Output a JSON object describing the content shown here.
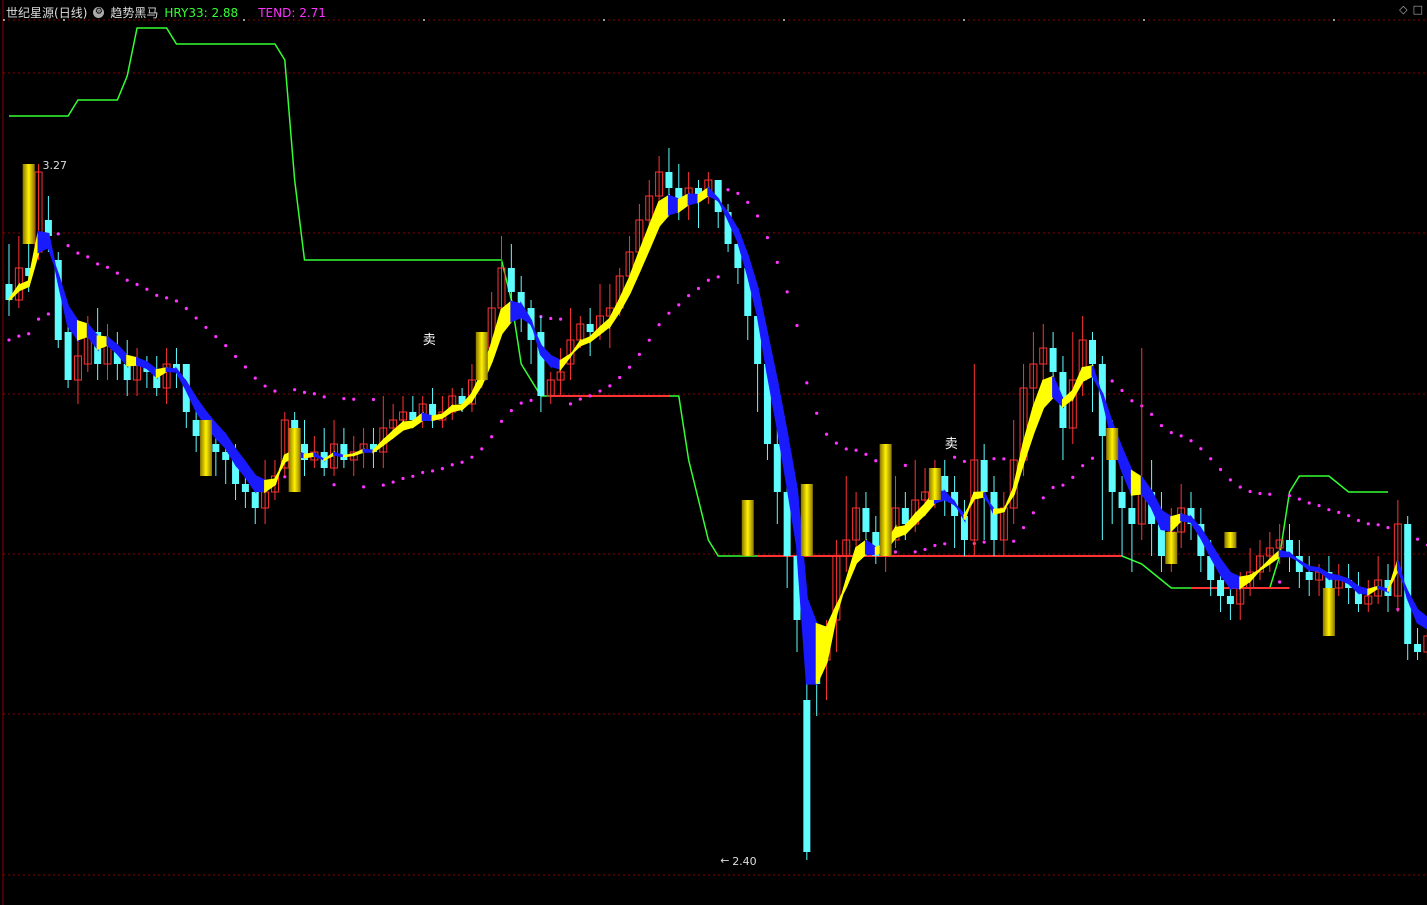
{
  "header": {
    "stock_name": "世纪星源",
    "period": "(日线)",
    "indicator_name": "趋势黑马",
    "hry_label": "HRY33",
    "hry_value": "2.88",
    "tend_label": "TEND",
    "tend_value": "2.71"
  },
  "colors": {
    "background": "#000000",
    "grid": "#8a0000",
    "up": "#ff3333",
    "down": "#5ffcff",
    "hry": "#33ff33",
    "tend": "#ff33ff",
    "ribbon_up": "#ffff00",
    "ribbon_down": "#1a1aff",
    "signal_bar": "#e8c400"
  },
  "chart_data": {
    "type": "candlestick",
    "ylim": [
      2.36,
      3.45
    ],
    "annotations": {
      "high_label": "3.27",
      "low_label": "2.40",
      "sell_marks": [
        "卖",
        "卖"
      ]
    },
    "candles": [
      [
        3.12,
        3.1,
        3.17,
        3.08
      ],
      [
        3.1,
        3.14,
        3.18,
        3.09
      ],
      [
        3.14,
        3.13,
        3.17,
        3.11
      ],
      [
        3.16,
        3.26,
        3.27,
        3.15
      ],
      [
        3.2,
        3.18,
        3.23,
        3.16
      ],
      [
        3.15,
        3.05,
        3.16,
        3.04
      ],
      [
        3.06,
        3.0,
        3.08,
        2.99
      ],
      [
        3.0,
        3.03,
        3.06,
        2.97
      ],
      [
        3.02,
        3.06,
        3.08,
        3.01
      ],
      [
        3.06,
        3.02,
        3.09,
        3.0
      ],
      [
        3.02,
        3.05,
        3.07,
        3.0
      ],
      [
        3.04,
        3.02,
        3.06,
        3.0
      ],
      [
        3.02,
        3.0,
        3.05,
        2.98
      ],
      [
        3.0,
        3.02,
        3.04,
        2.98
      ],
      [
        3.02,
        3.01,
        3.03,
        2.99
      ],
      [
        3.01,
        2.99,
        3.03,
        2.98
      ],
      [
        2.99,
        3.02,
        3.04,
        2.97
      ],
      [
        3.02,
        3.01,
        3.04,
        2.99
      ],
      [
        3.02,
        2.96,
        3.02,
        2.94
      ],
      [
        2.95,
        2.93,
        2.97,
        2.91
      ],
      [
        2.93,
        2.92,
        2.96,
        2.88
      ],
      [
        2.92,
        2.91,
        2.94,
        2.88
      ],
      [
        2.91,
        2.9,
        2.93,
        2.87
      ],
      [
        2.9,
        2.87,
        2.92,
        2.85
      ],
      [
        2.87,
        2.86,
        2.89,
        2.84
      ],
      [
        2.86,
        2.84,
        2.88,
        2.82
      ],
      [
        2.84,
        2.86,
        2.9,
        2.82
      ],
      [
        2.86,
        2.88,
        2.9,
        2.85
      ],
      [
        2.89,
        2.95,
        2.96,
        2.88
      ],
      [
        2.95,
        2.92,
        2.96,
        2.89
      ],
      [
        2.92,
        2.9,
        2.95,
        2.88
      ],
      [
        2.9,
        2.91,
        2.93,
        2.89
      ],
      [
        2.91,
        2.89,
        2.94,
        2.88
      ],
      [
        2.89,
        2.92,
        2.95,
        2.88
      ],
      [
        2.92,
        2.9,
        2.94,
        2.89
      ],
      [
        2.9,
        2.91,
        2.93,
        2.88
      ],
      [
        2.91,
        2.92,
        2.94,
        2.89
      ],
      [
        2.92,
        2.91,
        2.94,
        2.89
      ],
      [
        2.91,
        2.94,
        2.98,
        2.89
      ],
      [
        2.94,
        2.95,
        2.97,
        2.93
      ],
      [
        2.95,
        2.96,
        2.98,
        2.94
      ],
      [
        2.96,
        2.95,
        2.98,
        2.94
      ],
      [
        2.95,
        2.97,
        2.98,
        2.94
      ],
      [
        2.97,
        2.95,
        2.99,
        2.94
      ],
      [
        2.95,
        2.96,
        2.98,
        2.94
      ],
      [
        2.96,
        2.98,
        2.99,
        2.95
      ],
      [
        2.98,
        2.97,
        2.99,
        2.96
      ],
      [
        2.97,
        3.0,
        3.02,
        2.96
      ],
      [
        3.0,
        3.04,
        3.06,
        2.99
      ],
      [
        3.04,
        3.09,
        3.11,
        3.03
      ],
      [
        3.09,
        3.14,
        3.18,
        3.08
      ],
      [
        3.14,
        3.11,
        3.17,
        3.09
      ],
      [
        3.11,
        3.09,
        3.13,
        3.06
      ],
      [
        3.09,
        3.05,
        3.1,
        3.02
      ],
      [
        3.06,
        2.98,
        3.08,
        2.96
      ],
      [
        2.98,
        3.0,
        3.01,
        2.97
      ],
      [
        3.0,
        3.01,
        3.04,
        2.98
      ],
      [
        3.02,
        3.05,
        3.09,
        3.0
      ],
      [
        3.05,
        3.07,
        3.08,
        3.04
      ],
      [
        3.07,
        3.06,
        3.09,
        3.03
      ],
      [
        3.06,
        3.08,
        3.12,
        3.05
      ],
      [
        3.08,
        3.09,
        3.12,
        3.04
      ],
      [
        3.09,
        3.13,
        3.14,
        3.08
      ],
      [
        3.13,
        3.16,
        3.18,
        3.12
      ],
      [
        3.16,
        3.2,
        3.22,
        3.15
      ],
      [
        3.2,
        3.23,
        3.25,
        3.18
      ],
      [
        3.23,
        3.26,
        3.28,
        3.21
      ],
      [
        3.26,
        3.24,
        3.29,
        3.22
      ],
      [
        3.24,
        3.22,
        3.27,
        3.2
      ],
      [
        3.22,
        3.24,
        3.26,
        3.2
      ],
      [
        3.24,
        3.23,
        3.25,
        3.19
      ],
      [
        3.23,
        3.25,
        3.26,
        3.22
      ],
      [
        3.25,
        3.21,
        3.25,
        3.19
      ],
      [
        3.21,
        3.17,
        3.22,
        3.16
      ],
      [
        3.17,
        3.14,
        3.19,
        3.12
      ],
      [
        3.14,
        3.08,
        3.15,
        3.05
      ],
      [
        3.08,
        3.02,
        3.09,
        2.96
      ],
      [
        3.02,
        2.92,
        3.03,
        2.9
      ],
      [
        2.92,
        2.86,
        2.94,
        2.82
      ],
      [
        2.86,
        2.78,
        2.88,
        2.74
      ],
      [
        2.78,
        2.7,
        2.8,
        2.66
      ],
      [
        2.6,
        2.41,
        2.63,
        2.4
      ],
      [
        2.66,
        2.62,
        2.68,
        2.58
      ],
      [
        2.65,
        2.68,
        2.7,
        2.6
      ],
      [
        2.7,
        2.78,
        2.8,
        2.66
      ],
      [
        2.78,
        2.8,
        2.88,
        2.76
      ],
      [
        2.8,
        2.84,
        2.86,
        2.79
      ],
      [
        2.84,
        2.81,
        2.86,
        2.78
      ],
      [
        2.81,
        2.78,
        2.83,
        2.77
      ],
      [
        2.78,
        2.8,
        2.82,
        2.76
      ],
      [
        2.8,
        2.84,
        2.88,
        2.79
      ],
      [
        2.84,
        2.82,
        2.86,
        2.8
      ],
      [
        2.82,
        2.85,
        2.9,
        2.81
      ],
      [
        2.85,
        2.86,
        2.89,
        2.83
      ],
      [
        2.86,
        2.88,
        2.9,
        2.84
      ],
      [
        2.88,
        2.86,
        2.9,
        2.83
      ],
      [
        2.86,
        2.83,
        2.88,
        2.79
      ],
      [
        2.83,
        2.8,
        2.85,
        2.78
      ],
      [
        2.8,
        2.9,
        3.02,
        2.78
      ],
      [
        2.9,
        2.86,
        2.92,
        2.8
      ],
      [
        2.86,
        2.8,
        2.88,
        2.78
      ],
      [
        2.8,
        2.84,
        2.86,
        2.78
      ],
      [
        2.84,
        2.9,
        2.95,
        2.82
      ],
      [
        2.9,
        2.99,
        3.02,
        2.88
      ],
      [
        2.99,
        3.02,
        3.06,
        2.96
      ],
      [
        3.02,
        3.04,
        3.07,
        3.0
      ],
      [
        3.04,
        3.01,
        3.06,
        2.98
      ],
      [
        3.01,
        2.94,
        3.03,
        2.9
      ],
      [
        2.94,
        3.0,
        3.06,
        2.92
      ],
      [
        3.0,
        3.05,
        3.08,
        2.98
      ],
      [
        3.05,
        3.02,
        3.06,
        2.96
      ],
      [
        3.02,
        2.93,
        3.03,
        2.8
      ],
      [
        2.93,
        2.86,
        2.95,
        2.82
      ],
      [
        2.86,
        2.84,
        2.88,
        2.78
      ],
      [
        2.84,
        2.82,
        2.86,
        2.76
      ],
      [
        2.82,
        2.86,
        3.04,
        2.8
      ],
      [
        2.86,
        2.82,
        2.9,
        2.78
      ],
      [
        2.82,
        2.78,
        2.86,
        2.76
      ],
      [
        2.78,
        2.81,
        2.84,
        2.76
      ],
      [
        2.81,
        2.84,
        2.87,
        2.79
      ],
      [
        2.84,
        2.82,
        2.86,
        2.8
      ],
      [
        2.82,
        2.78,
        2.84,
        2.76
      ],
      [
        2.78,
        2.75,
        2.8,
        2.73
      ],
      [
        2.75,
        2.73,
        2.77,
        2.71
      ],
      [
        2.73,
        2.72,
        2.75,
        2.7
      ],
      [
        2.72,
        2.74,
        2.76,
        2.7
      ],
      [
        2.74,
        2.76,
        2.79,
        2.73
      ],
      [
        2.76,
        2.78,
        2.8,
        2.75
      ],
      [
        2.78,
        2.79,
        2.81,
        2.76
      ],
      [
        2.79,
        2.8,
        2.82,
        2.77
      ],
      [
        2.8,
        2.78,
        2.82,
        2.76
      ],
      [
        2.78,
        2.76,
        2.8,
        2.74
      ],
      [
        2.76,
        2.75,
        2.78,
        2.73
      ],
      [
        2.75,
        2.76,
        2.77,
        2.73
      ],
      [
        2.76,
        2.74,
        2.78,
        2.73
      ],
      [
        2.74,
        2.75,
        2.77,
        2.73
      ],
      [
        2.75,
        2.74,
        2.77,
        2.72
      ],
      [
        2.74,
        2.72,
        2.76,
        2.71
      ],
      [
        2.72,
        2.73,
        2.75,
        2.71
      ],
      [
        2.73,
        2.75,
        2.78,
        2.72
      ],
      [
        2.75,
        2.73,
        2.77,
        2.71
      ],
      [
        2.73,
        2.82,
        2.85,
        2.71
      ],
      [
        2.82,
        2.67,
        2.83,
        2.65
      ],
      [
        2.67,
        2.66,
        2.69,
        2.65
      ],
      [
        2.66,
        2.68,
        2.7,
        2.65
      ],
      [
        2.68,
        2.67,
        2.7,
        2.66
      ]
    ],
    "hry_line": [
      [
        0,
        3.33
      ],
      [
        6,
        3.33
      ],
      [
        7,
        3.35
      ],
      [
        9,
        3.35
      ],
      [
        11,
        3.35
      ],
      [
        12,
        3.38
      ],
      [
        13,
        3.44
      ],
      [
        14,
        3.44
      ],
      [
        16,
        3.44
      ],
      [
        17,
        3.42
      ],
      [
        19,
        3.42
      ],
      [
        27,
        3.42
      ],
      [
        28,
        3.4
      ],
      [
        29,
        3.25
      ],
      [
        30,
        3.15
      ],
      [
        32,
        3.15
      ],
      [
        50,
        3.15
      ],
      [
        51,
        3.1
      ],
      [
        52,
        3.02
      ],
      [
        53,
        3.0
      ],
      [
        54,
        2.98
      ],
      [
        55,
        2.98
      ],
      [
        65,
        2.98
      ],
      [
        68,
        2.98
      ],
      [
        69,
        2.9
      ],
      [
        71,
        2.8
      ],
      [
        72,
        2.78
      ],
      [
        73,
        2.78
      ],
      [
        78,
        2.78
      ],
      [
        110,
        2.78
      ],
      [
        113,
        2.78
      ],
      [
        115,
        2.77
      ],
      [
        118,
        2.74
      ],
      [
        121,
        2.74
      ],
      [
        128,
        2.74
      ],
      [
        129,
        2.78
      ],
      [
        130,
        2.86
      ],
      [
        131,
        2.88
      ],
      [
        134,
        2.88
      ],
      [
        136,
        2.86
      ],
      [
        140,
        2.86
      ]
    ],
    "red_segments": [
      [
        55,
        2.98,
        67,
        2.98
      ],
      [
        76,
        2.78,
        113,
        2.78
      ],
      [
        120,
        2.74,
        130,
        2.74
      ]
    ],
    "sell_label_indices": [
      42,
      95
    ],
    "signal_bars": [
      [
        2,
        3.17,
        3.27
      ],
      [
        20,
        2.88,
        2.95
      ],
      [
        29,
        2.86,
        2.94
      ],
      [
        48,
        3.0,
        3.06
      ],
      [
        75,
        2.78,
        2.85
      ],
      [
        81,
        2.78,
        2.87
      ],
      [
        89,
        2.78,
        2.92
      ],
      [
        94,
        2.85,
        2.89
      ],
      [
        112,
        2.9,
        2.94
      ],
      [
        118,
        2.77,
        2.81
      ],
      [
        124,
        2.79,
        2.81
      ],
      [
        134,
        2.68,
        2.74
      ]
    ]
  }
}
